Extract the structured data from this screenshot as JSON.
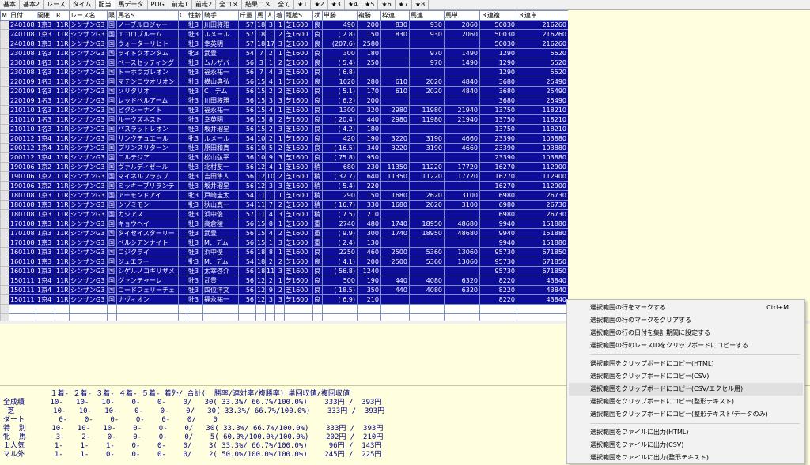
{
  "tabs": [
    "基本",
    "基本2",
    "レース",
    "タイム",
    "配当",
    "馬データ",
    "POG",
    "前走1",
    "前走2",
    "全コメ",
    "結果コメ",
    "全て",
    "★1",
    "★2",
    "★3",
    "★4",
    "★5",
    "★6",
    "★7",
    "★8"
  ],
  "active_tab": 4,
  "columns": [
    "M",
    "日付",
    "開催",
    "R",
    "レース名",
    "限",
    "馬名S",
    "C",
    "性齢",
    "騎手",
    "斤量",
    "馬",
    "人",
    "着",
    "距離S",
    "状",
    "単勝",
    "複勝",
    "枠連",
    "馬連",
    "馬単",
    "３連複",
    "３連単"
  ],
  "rows": [
    [
      "",
      "240108",
      "1京3",
      "11R",
      "シンザンG3",
      "国",
      "ノーブルロジャー",
      "",
      "牡3",
      "川田将雅",
      "57",
      "18",
      "3",
      "1",
      "芝1600",
      "良",
      "490",
      "200",
      "830",
      "930",
      "2060",
      "50030",
      "216260"
    ],
    [
      "",
      "240108",
      "1京3",
      "11R",
      "シンザンG3",
      "国",
      "エコロブルーム",
      "",
      "牡3",
      "ルメール",
      "57",
      "18",
      "1",
      "2",
      "芝1600",
      "良",
      "( 2.8)",
      "150",
      "830",
      "930",
      "2060",
      "50030",
      "216260"
    ],
    [
      "",
      "240108",
      "1京3",
      "11R",
      "シンザンG3",
      "国",
      "ウォーターリヒト",
      "",
      "牡3",
      "幸英明",
      "57",
      "18",
      "17",
      "3",
      "芝1600",
      "良",
      "(207.6)",
      "2580",
      "",
      "",
      "",
      "50030",
      "216260"
    ],
    [
      "",
      "230108",
      "1名3",
      "11R",
      "シンザンG3",
      "国",
      "ライトクオンタム",
      "",
      "牝3",
      "武豊",
      "54",
      "7",
      "2",
      "1",
      "芝1600",
      "良",
      "300",
      "180",
      "",
      "970",
      "1490",
      "1290",
      "5520"
    ],
    [
      "",
      "230108",
      "1名3",
      "11R",
      "シンザンG3",
      "国",
      "ペースセッティング",
      "",
      "牡3",
      "ムルザバ",
      "56",
      "3",
      "1",
      "2",
      "芝1600",
      "良",
      "( 5.4)",
      "250",
      "",
      "970",
      "1490",
      "1290",
      "5520"
    ],
    [
      "",
      "230108",
      "1名3",
      "11R",
      "シンザンG3",
      "国",
      "トーホウガレオン",
      "",
      "牡3",
      "福永祐一",
      "56",
      "7",
      "4",
      "3",
      "芝1600",
      "良",
      "( 6.8)",
      "",
      "",
      "",
      "",
      "1290",
      "5520"
    ],
    [
      "",
      "220109",
      "1名3",
      "11R",
      "シンザンG3",
      "国",
      "マテンロウオリオン",
      "",
      "牡3",
      "横山典弘",
      "56",
      "15",
      "4",
      "1",
      "芝1600",
      "良",
      "1020",
      "280",
      "610",
      "2020",
      "4840",
      "3680",
      "25490"
    ],
    [
      "",
      "220109",
      "1名3",
      "11R",
      "シンザンG3",
      "国",
      "ソリタリオ",
      "",
      "牡3",
      "C．デム",
      "56",
      "15",
      "2",
      "2",
      "芝1600",
      "良",
      "( 5.1)",
      "170",
      "610",
      "2020",
      "4840",
      "3680",
      "25490"
    ],
    [
      "",
      "220109",
      "1名3",
      "11R",
      "シンザンG3",
      "国",
      "レッドベルアーム",
      "",
      "牡3",
      "川田将雅",
      "56",
      "15",
      "3",
      "3",
      "芝1600",
      "良",
      "( 6.2)",
      "200",
      "",
      "",
      "",
      "3680",
      "25490"
    ],
    [
      "",
      "210110",
      "1名3",
      "11R",
      "シンザンG3",
      "国",
      "ピクシーナイト",
      "",
      "牡3",
      "福永祐一",
      "56",
      "15",
      "4",
      "1",
      "芝1600",
      "良",
      "1300",
      "320",
      "2980",
      "11980",
      "21940",
      "13750",
      "118210"
    ],
    [
      "",
      "210110",
      "1名3",
      "11R",
      "シンザンG3",
      "国",
      "ルークズネスト",
      "",
      "牡3",
      "幸英明",
      "56",
      "15",
      "8",
      "2",
      "芝1600",
      "良",
      "( 20.4)",
      "440",
      "2980",
      "11980",
      "21940",
      "13750",
      "118210"
    ],
    [
      "",
      "210110",
      "1名3",
      "11R",
      "シンザンG3",
      "国",
      "バスラットレオン",
      "",
      "牡3",
      "坂井瑠星",
      "56",
      "15",
      "2",
      "3",
      "芝1600",
      "良",
      "( 4.2)",
      "180",
      "",
      "",
      "",
      "13750",
      "118210"
    ],
    [
      "",
      "200112",
      "1京4",
      "11R",
      "シンザンG3",
      "国",
      "サンクテュエール",
      "",
      "牝3",
      "ルメール",
      "54",
      "10",
      "2",
      "1",
      "芝1600",
      "良",
      "420",
      "190",
      "3220",
      "3190",
      "4660",
      "23390",
      "103880"
    ],
    [
      "",
      "200112",
      "1京4",
      "11R",
      "シンザンG3",
      "国",
      "プリンスリターン",
      "",
      "牡3",
      "原田和真",
      "56",
      "10",
      "5",
      "2",
      "芝1600",
      "良",
      "( 16.5)",
      "340",
      "3220",
      "3190",
      "4660",
      "23390",
      "103880"
    ],
    [
      "",
      "200112",
      "1京4",
      "11R",
      "シンザンG3",
      "国",
      "コルテジア",
      "",
      "牡3",
      "松山弘平",
      "56",
      "10",
      "9",
      "3",
      "芝1600",
      "良",
      "( 75.8)",
      "950",
      "",
      "",
      "",
      "23390",
      "103880"
    ],
    [
      "",
      "190106",
      "1京2",
      "11R",
      "シンザンG3",
      "国",
      "ヴァルディゼール",
      "",
      "牡3",
      "北村友一",
      "56",
      "12",
      "4",
      "1",
      "芝1600",
      "稍",
      "680",
      "230",
      "11350",
      "11220",
      "17720",
      "16270",
      "112900"
    ],
    [
      "",
      "190106",
      "1京2",
      "11R",
      "シンザンG3",
      "国",
      "マイネルフラップ",
      "",
      "牡3",
      "吉田隼人",
      "56",
      "12",
      "10",
      "2",
      "芝1600",
      "稍",
      "( 32.7)",
      "640",
      "11350",
      "11220",
      "17720",
      "16270",
      "112900"
    ],
    [
      "",
      "190106",
      "1京2",
      "11R",
      "シンザンG3",
      "国",
      "ミッキーブリランテ",
      "",
      "牡3",
      "坂井瑠星",
      "56",
      "12",
      "3",
      "3",
      "芝1600",
      "稍",
      "( 5.4)",
      "220",
      "",
      "",
      "",
      "16270",
      "112900"
    ],
    [
      "",
      "180108",
      "1京3",
      "11R",
      "シンザンG3",
      "国",
      "アーモンドアイ",
      "",
      "牝3",
      "戸崎圭太",
      "54",
      "11",
      "1",
      "1",
      "芝1600",
      "稍",
      "290",
      "150",
      "1680",
      "2620",
      "3100",
      "6980",
      "26730"
    ],
    [
      "",
      "180108",
      "1京3",
      "11R",
      "シンザンG3",
      "国",
      "ツヅミモン",
      "",
      "牝3",
      "秋山真一",
      "54",
      "11",
      "7",
      "2",
      "芝1600",
      "稍",
      "( 16.7)",
      "330",
      "1680",
      "2620",
      "3100",
      "6980",
      "26730"
    ],
    [
      "",
      "180108",
      "1京3",
      "11R",
      "シンザンG3",
      "国",
      "カシアス",
      "",
      "牡3",
      "浜中俊",
      "57",
      "11",
      "4",
      "3",
      "芝1600",
      "稍",
      "( 7.5)",
      "210",
      "",
      "",
      "",
      "6980",
      "26730"
    ],
    [
      "",
      "170108",
      "1京3",
      "11R",
      "シンザンG3",
      "国",
      "キョウヘイ",
      "",
      "牡3",
      "高倉稜",
      "56",
      "15",
      "8",
      "1",
      "芝1600",
      "重",
      "2740",
      "480",
      "1740",
      "18950",
      "48680",
      "9940",
      "151880"
    ],
    [
      "",
      "170108",
      "1京3",
      "11R",
      "シンザンG3",
      "国",
      "タイセイスターリー",
      "",
      "牡3",
      "武豊",
      "56",
      "15",
      "4",
      "2",
      "芝1600",
      "重",
      "( 9.9)",
      "300",
      "1740",
      "18950",
      "48680",
      "9940",
      "151880"
    ],
    [
      "",
      "170108",
      "1京3",
      "11R",
      "シンザンG3",
      "国",
      "ペルシアンナイト",
      "",
      "牡3",
      "M．デム",
      "56",
      "15",
      "1",
      "3",
      "芝1600",
      "重",
      "( 2.4)",
      "130",
      "",
      "",
      "",
      "9940",
      "151880"
    ],
    [
      "",
      "160110",
      "1京3",
      "11R",
      "シンザンG3",
      "国",
      "ロジクライ",
      "",
      "牡3",
      "浜中俊",
      "56",
      "18",
      "8",
      "1",
      "芝1600",
      "良",
      "2250",
      "460",
      "2500",
      "5360",
      "13060",
      "95730",
      "671850"
    ],
    [
      "",
      "160110",
      "1京3",
      "11R",
      "シンザンG3",
      "国",
      "ジュエラー",
      "",
      "牝3",
      "M．デム",
      "54",
      "18",
      "2",
      "2",
      "芝1600",
      "良",
      "( 4.1)",
      "200",
      "2500",
      "5360",
      "13060",
      "95730",
      "671850"
    ],
    [
      "",
      "160110",
      "1京3",
      "11R",
      "シンザンG3",
      "国",
      "シゲルノコギリザメ",
      "",
      "牡3",
      "太宰啓介",
      "56",
      "18",
      "11",
      "3",
      "芝1600",
      "良",
      "( 56.8)",
      "1240",
      "",
      "",
      "",
      "95730",
      "671850"
    ],
    [
      "",
      "150111",
      "1京4",
      "11R",
      "シンザンG3",
      "国",
      "グァンチャーレ",
      "",
      "牡3",
      "武豊",
      "56",
      "12",
      "2",
      "1",
      "芝1600",
      "良",
      "500",
      "190",
      "440",
      "4080",
      "6320",
      "8220",
      "43840"
    ],
    [
      "",
      "150111",
      "1京4",
      "11R",
      "シンザンG3",
      "国",
      "ロードフェリーチェ",
      "",
      "牡3",
      "四位洋文",
      "56",
      "12",
      "9",
      "2",
      "芝1600",
      "良",
      "( 18.5)",
      "350",
      "440",
      "4080",
      "6320",
      "8220",
      "43840"
    ],
    [
      "",
      "150111",
      "1京4",
      "11R",
      "シンザンG3",
      "国",
      "ナヴィオン",
      "",
      "牡3",
      "福永祐一",
      "56",
      "12",
      "3",
      "3",
      "芝1600",
      "良",
      "( 6.9)",
      "210",
      "",
      "",
      "",
      "8220",
      "43840"
    ]
  ],
  "summary_lines": [
    "           １着- ２着- ３着- ４着- ５着- 着外/ 合計(  勝率/連対率/複勝率) 単回収値/複回収値",
    "全成績      10-   10-   10-    0-    0-    0/   30( 33.3%/ 66.7%/100.0%)    333円 /  393円",
    " 芝         10-   10-   10-    0-    0-    0/   30( 33.3%/ 66.7%/100.0%)    333円 /  393円",
    "ダート        0-    0-    0-    0-    0-    0/    0",
    "特  別      10-   10-   10-    0-    0-    0/   30( 33.3%/ 66.7%/100.0%)    333円 /  393円",
    "牝  馬       3-    2-    0-    0-    0-    0/    5( 60.0%/100.0%/100.0%)    202円 /  210円",
    "１人気       1-    1-    1-    0-    0-    0/    3( 33.3%/ 66.7%/100.0%)     96円 /  143円",
    "マル外       1-    1-    0-    0-    0-    0/    2( 50.0%/100.0%/100.0%)    245円 /  225円"
  ],
  "context_menu": {
    "items": [
      {
        "label": "選択範囲の行をマークする",
        "shortcut": "Ctrl+M"
      },
      {
        "label": "選択範囲の行のマークをクリアする",
        "shortcut": ""
      },
      {
        "label": "選択範囲の行の日付を集計期間に設定する",
        "shortcut": ""
      },
      {
        "label": "選択範囲の行のレースIDをクリップボードにコピーする",
        "shortcut": ""
      },
      {
        "label": "選択範囲をクリップボードにコピー(HTML)",
        "shortcut": ""
      },
      {
        "label": "選択範囲をクリップボードにコピー(CSV)",
        "shortcut": ""
      },
      {
        "label": "選択範囲をクリップボードにコピー(CSV/エクセル用)",
        "shortcut": ""
      },
      {
        "label": "選択範囲をクリップボードにコピー(整形テキスト)",
        "shortcut": ""
      },
      {
        "label": "選択範囲をクリップボードにコピー(整形テキスト/データのみ)",
        "shortcut": ""
      },
      {
        "label": "選択範囲をファイルに出力(HTML)",
        "shortcut": ""
      },
      {
        "label": "選択範囲をファイルに出力(CSV)",
        "shortcut": ""
      },
      {
        "label": "選択範囲をファイルに出力(整形テキスト)",
        "shortcut": ""
      }
    ]
  }
}
